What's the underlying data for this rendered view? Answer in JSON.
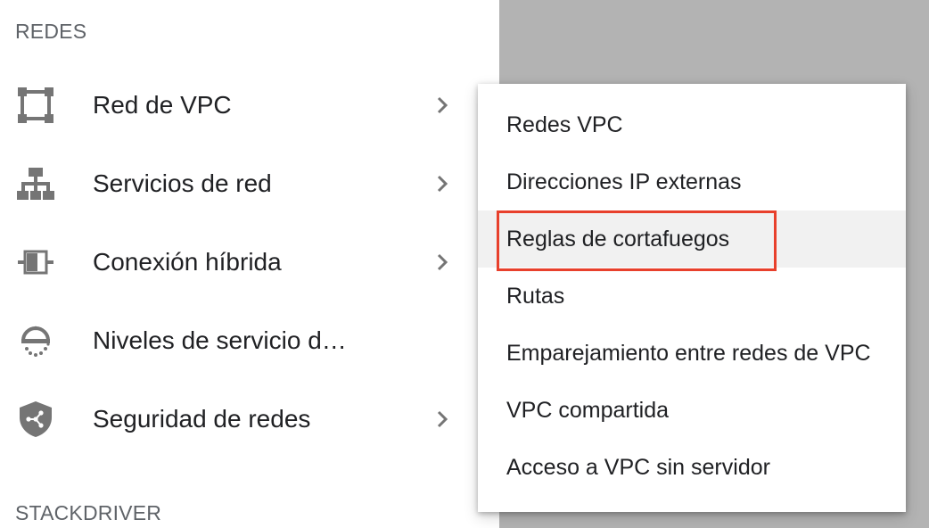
{
  "sections": {
    "networking_header": "REDES",
    "stackdriver_header": "STACKDRIVER"
  },
  "nav_items": [
    {
      "label": "Red de VPC",
      "icon": "vpc-network-icon",
      "has_submenu": true
    },
    {
      "label": "Servicios de red",
      "icon": "network-services-icon",
      "has_submenu": true
    },
    {
      "label": "Conexión híbrida",
      "icon": "hybrid-connectivity-icon",
      "has_submenu": true
    },
    {
      "label": "Niveles de servicio d…",
      "icon": "network-service-tiers-icon",
      "has_submenu": false
    },
    {
      "label": "Seguridad de redes",
      "icon": "network-security-icon",
      "has_submenu": true
    }
  ],
  "flyout_items": [
    {
      "label": "Redes VPC"
    },
    {
      "label": "Direcciones IP externas"
    },
    {
      "label": "Reglas de cortafuegos",
      "highlighted": true
    },
    {
      "label": "Rutas"
    },
    {
      "label": "Emparejamiento entre redes de VPC"
    },
    {
      "label": "VPC compartida"
    },
    {
      "label": "Acceso a VPC sin servidor"
    }
  ],
  "colors": {
    "icon_gray": "#757575",
    "text_primary": "#202124",
    "header_gray": "#5f6368",
    "highlight_red": "#e8402c",
    "hover_bg": "#f1f1f1",
    "backdrop": "#b3b3b3"
  }
}
